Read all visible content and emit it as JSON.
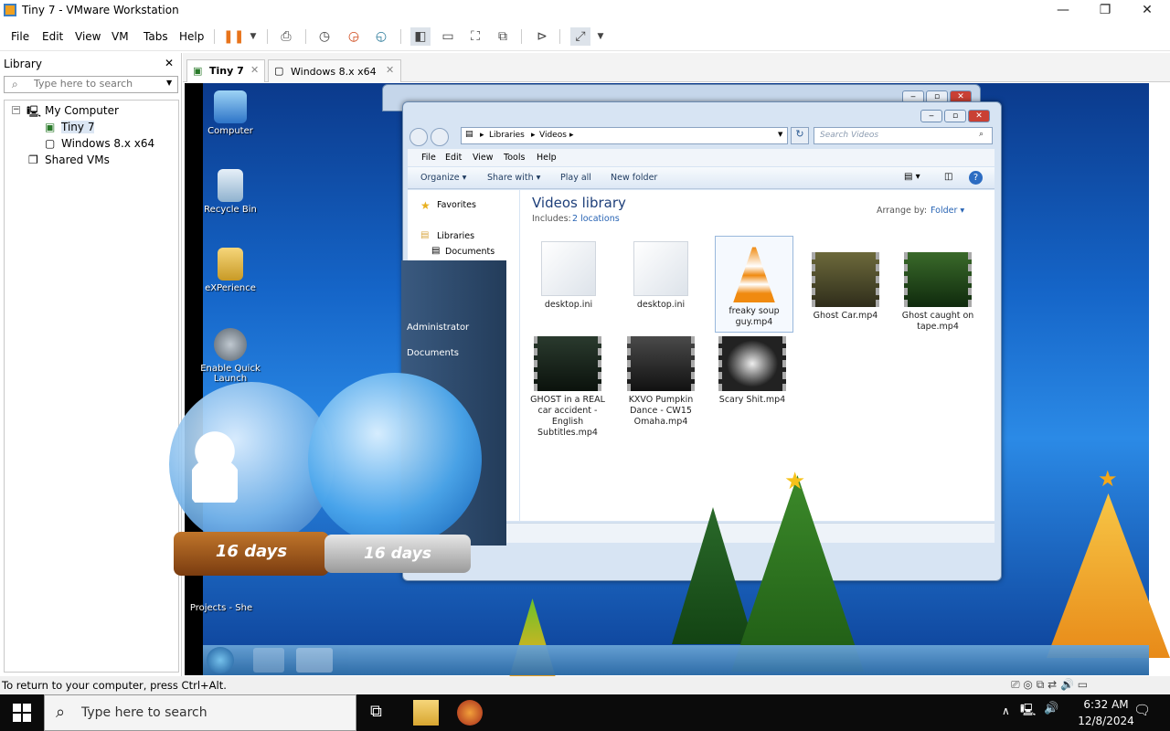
{
  "window": {
    "title": "Tiny 7 - VMware Workstation",
    "min": "—",
    "max": "❐",
    "close": "✕"
  },
  "menu": [
    "File",
    "Edit",
    "View",
    "VM",
    "Tabs",
    "Help"
  ],
  "library": {
    "title": "Library",
    "close": "✕",
    "search_placeholder": "Type here to search",
    "tree": {
      "my_computer": "My Computer",
      "vm1": "Tiny 7",
      "vm2": "Windows 8.x x64",
      "shared": "Shared VMs"
    }
  },
  "tabs": [
    {
      "label": "Tiny 7"
    },
    {
      "label": "Windows 8.x x64"
    }
  ],
  "desktop_icons": [
    "Computer",
    "Recycle Bin",
    "eXPerience",
    "Enable Quick Launch",
    "Projects - She"
  ],
  "explorer": {
    "address": [
      "Libraries",
      "Videos"
    ],
    "search_placeholder": "Search Videos",
    "menu": [
      "File",
      "Edit",
      "View",
      "Tools",
      "Help"
    ],
    "commands": [
      "Organize ▾",
      "Share with ▾",
      "Play all",
      "New folder"
    ],
    "nav": [
      "Favorites",
      "Libraries",
      "Documents"
    ],
    "library_title": "Videos library",
    "includes_label": "Includes:",
    "includes_link": "2 locations",
    "arrange_label": "Arrange by:",
    "arrange_value": "Folder ▾",
    "files": [
      {
        "name": "desktop.ini",
        "kind": "ini"
      },
      {
        "name": "desktop.ini",
        "kind": "ini"
      },
      {
        "name": "freaky soup guy.mp4",
        "kind": "vlc"
      },
      {
        "name": "Ghost Car.mp4",
        "kind": "video"
      },
      {
        "name": "Ghost caught on tape.mp4",
        "kind": "video"
      },
      {
        "name": "GHOST in a REAL car accident - English Subtitles.mp4",
        "kind": "video"
      },
      {
        "name": "KXVO Pumpkin Dance - CW15 Omaha.mp4",
        "kind": "video"
      },
      {
        "name": "Scary Shit.mp4",
        "kind": "video"
      }
    ]
  },
  "start_panel": [
    "Administrator",
    "Documents"
  ],
  "gadgets": {
    "globe1": "16 days",
    "globe2": "16 days"
  },
  "statusbar": "To return to your computer, press Ctrl+Alt.",
  "win_taskbar": {
    "search_placeholder": "Type here to search",
    "time": "6:32 AM",
    "date": "12/8/2024"
  }
}
